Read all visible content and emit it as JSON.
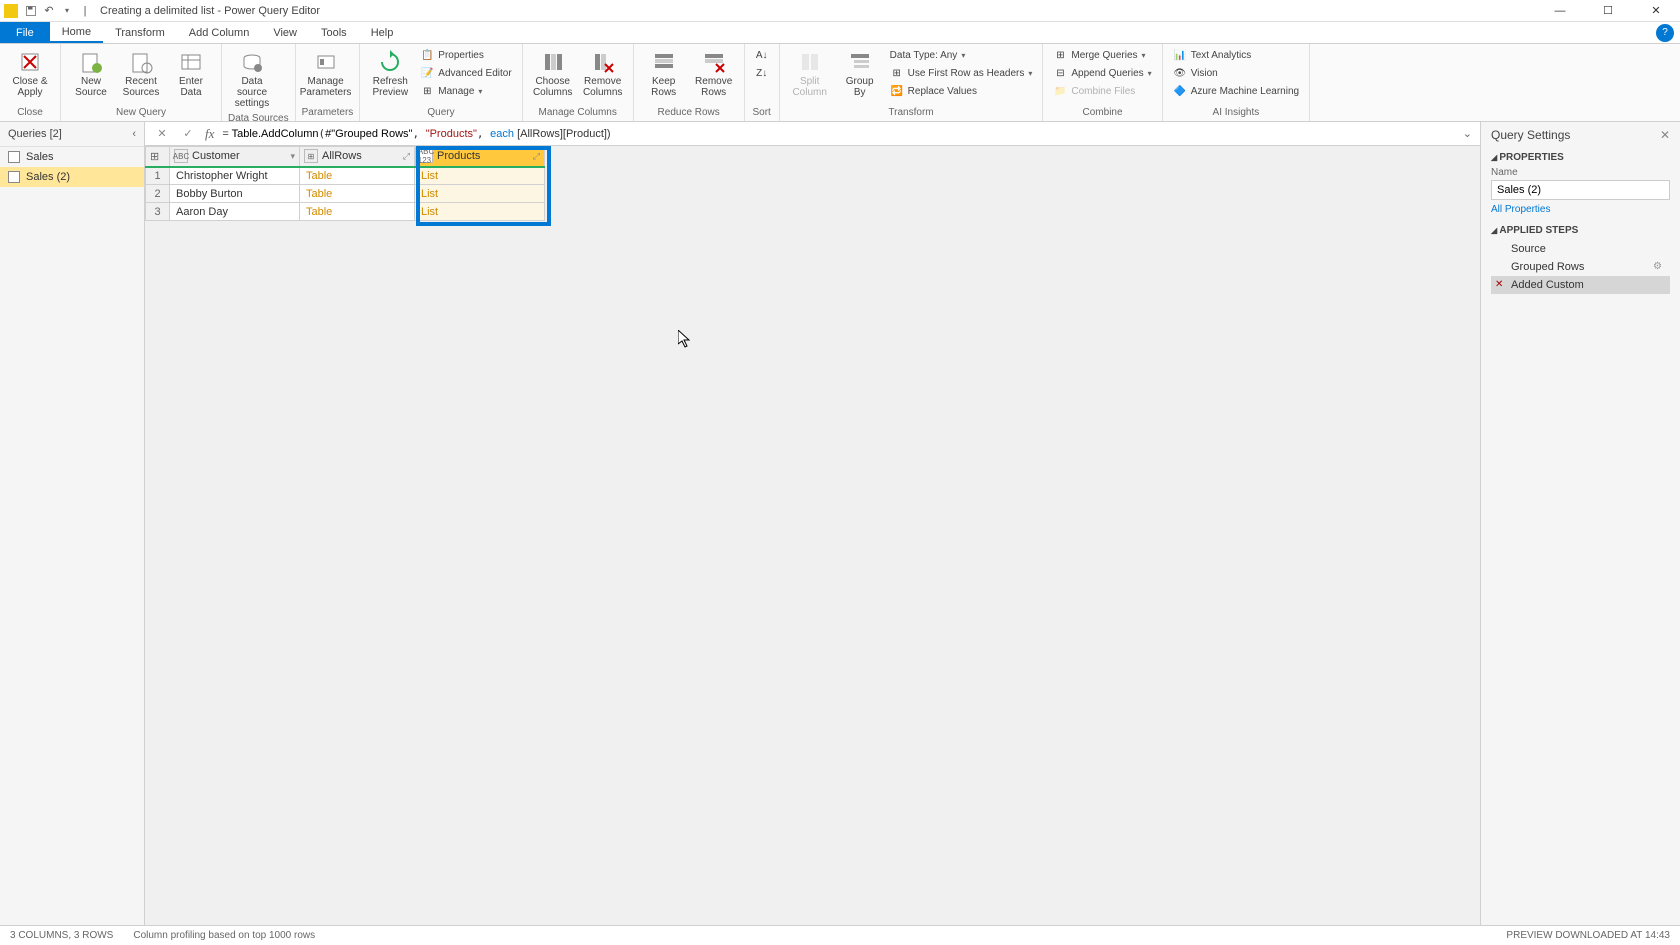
{
  "titlebar": {
    "title": "Creating a delimited list - Power Query Editor"
  },
  "menu": {
    "file": "File",
    "home": "Home",
    "transform": "Transform",
    "add_column": "Add Column",
    "view": "View",
    "tools": "Tools",
    "help": "Help"
  },
  "ribbon": {
    "close_apply": "Close &\nApply",
    "close_group": "Close",
    "new_source": "New\nSource",
    "recent_sources": "Recent\nSources",
    "enter_data": "Enter\nData",
    "new_query_group": "New Query",
    "data_source_settings": "Data source\nsettings",
    "data_sources_group": "Data Sources",
    "manage_parameters": "Manage\nParameters",
    "parameters_group": "Parameters",
    "refresh_preview": "Refresh\nPreview",
    "properties": "Properties",
    "advanced_editor": "Advanced Editor",
    "manage": "Manage",
    "query_group": "Query",
    "choose_columns": "Choose\nColumns",
    "remove_columns": "Remove\nColumns",
    "manage_columns_group": "Manage Columns",
    "keep_rows": "Keep\nRows",
    "remove_rows": "Remove\nRows",
    "reduce_rows_group": "Reduce Rows",
    "sort_group": "Sort",
    "split_column": "Split\nColumn",
    "group_by": "Group\nBy",
    "data_type": "Data Type: Any",
    "first_row_headers": "Use First Row as Headers",
    "replace_values": "Replace Values",
    "transform_group": "Transform",
    "merge_queries": "Merge Queries",
    "append_queries": "Append Queries",
    "combine_files": "Combine Files",
    "combine_group": "Combine",
    "text_analytics": "Text Analytics",
    "vision": "Vision",
    "azure_ml": "Azure Machine Learning",
    "ai_insights_group": "AI Insights"
  },
  "queries": {
    "header": "Queries [2]",
    "items": [
      "Sales",
      "Sales (2)"
    ]
  },
  "formula": {
    "prefix": "= ",
    "fn": "Table.AddColumn",
    "arg1": "#\"Grouped Rows\"",
    "arg2": "\"Products\"",
    "each": "each",
    "arg3": " [AllRows][Product])"
  },
  "grid": {
    "columns": [
      "Customer",
      "AllRows",
      "Products"
    ],
    "rows": [
      {
        "idx": "1",
        "customer": "Christopher Wright",
        "allrows": "Table",
        "products": "List"
      },
      {
        "idx": "2",
        "customer": "Bobby Burton",
        "allrows": "Table",
        "products": "List"
      },
      {
        "idx": "3",
        "customer": "Aaron Day",
        "allrows": "Table",
        "products": "List"
      }
    ]
  },
  "settings": {
    "title": "Query Settings",
    "properties": "PROPERTIES",
    "name_label": "Name",
    "name_value": "Sales (2)",
    "all_properties": "All Properties",
    "applied_steps": "APPLIED STEPS",
    "steps": [
      "Source",
      "Grouped Rows",
      "Added Custom"
    ]
  },
  "status": {
    "left1": "3 COLUMNS, 3 ROWS",
    "left2": "Column profiling based on top 1000 rows",
    "right": "PREVIEW DOWNLOADED AT 14:43"
  }
}
